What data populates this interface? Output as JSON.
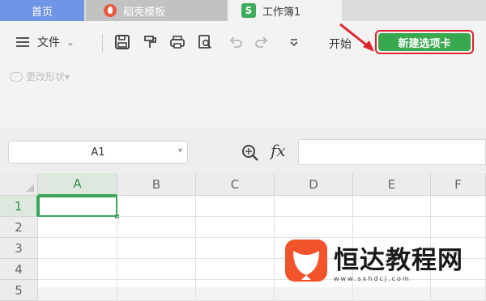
{
  "tabs": [
    {
      "label": "首页"
    },
    {
      "label": "稻壳模板",
      "icon": "docer-icon"
    },
    {
      "label": "工作簿1",
      "icon": "spreadsheet-s-icon",
      "icon_text": "S"
    }
  ],
  "ribbon": {
    "file_menu_label": "文件",
    "start_label": "开始",
    "new_tab_button_label": "新建选项卡",
    "shape_button_label": "更改形状",
    "shape_button_chevron": "▾",
    "file_menu_chevron": "⌄"
  },
  "formula_bar": {
    "name_box_value": "A1",
    "name_box_chevron": "▾",
    "fx_label": "fx",
    "formula_value": ""
  },
  "grid": {
    "columns": [
      "A",
      "B",
      "C",
      "D",
      "E",
      "F"
    ],
    "rows": [
      "1",
      "2",
      "3",
      "4",
      "5"
    ],
    "active_cell": "A1"
  },
  "watermark": {
    "title": "恒达教程网",
    "url": "www.sxhdcj.com"
  },
  "colors": {
    "accent_green": "#37a84e",
    "highlight_red": "#e0242a",
    "home_tab_blue": "#6f95e6"
  }
}
